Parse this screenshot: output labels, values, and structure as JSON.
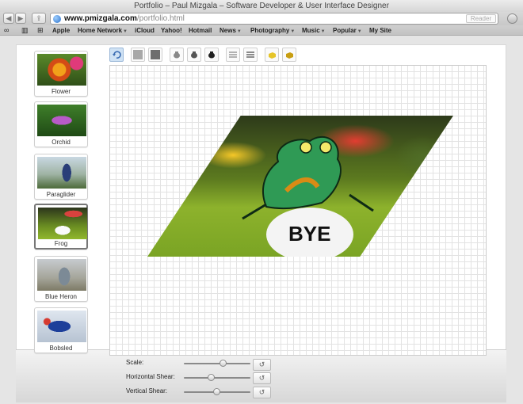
{
  "window": {
    "title": "Portfolio – Paul Mizgala – Software Developer & User Interface Designer"
  },
  "toolbar": {
    "url_domain": "www.pmizgala.com",
    "url_path": "/portfolio.html",
    "reader_label": "Reader"
  },
  "bookmarks": [
    {
      "label": "Apple",
      "menu": false
    },
    {
      "label": "Home Network",
      "menu": true
    },
    {
      "label": "iCloud",
      "menu": false
    },
    {
      "label": "Yahoo!",
      "menu": false
    },
    {
      "label": "Hotmail",
      "menu": false
    },
    {
      "label": "News",
      "menu": true
    },
    {
      "label": "Photography",
      "menu": true
    },
    {
      "label": "Music",
      "menu": true
    },
    {
      "label": "Popular",
      "menu": true
    },
    {
      "label": "My Site",
      "menu": false
    }
  ],
  "gallery": {
    "items": [
      {
        "label": "Flower"
      },
      {
        "label": "Orchid"
      },
      {
        "label": "Paraglider"
      },
      {
        "label": "Frog"
      },
      {
        "label": "Blue Heron"
      },
      {
        "label": "Bobsled"
      }
    ],
    "selected": "Frog"
  },
  "preview": {
    "sign_text": "BYE"
  },
  "controls": {
    "scale_label": "Scale:",
    "hshear_label": "Horizontal Shear:",
    "vshear_label": "Vertical Shear:",
    "scale_value": 0.6,
    "hshear_value": 0.42,
    "vshear_value": 0.5
  },
  "colors": {
    "accent": "#cfe2f4",
    "grid": "#e3e3e3"
  }
}
